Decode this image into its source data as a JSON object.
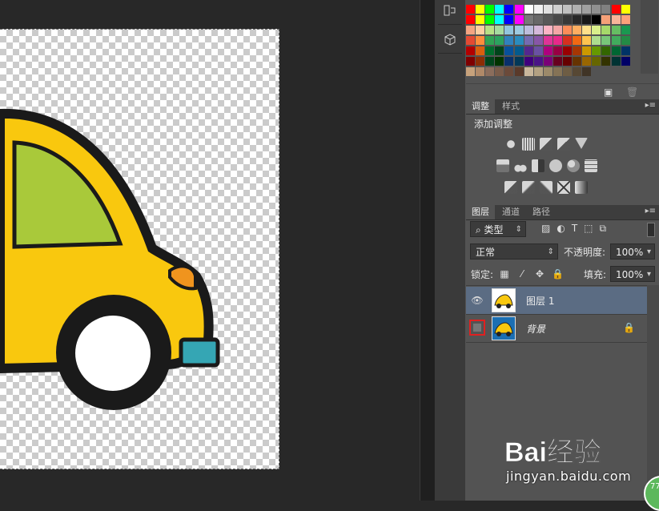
{
  "toolbar_strip": {
    "history_icon": "history-icon",
    "properties_icon": "3d-cube-icon"
  },
  "swatches": {
    "rows": [
      [
        "#ff0000",
        "#ffff00",
        "#00ff00",
        "#00ffff",
        "#0000ff",
        "#ff00ff",
        "#ffffff",
        "#f0f0f0",
        "#e0e0e0",
        "#d0d0d0",
        "#c0c0c0",
        "#b0b0b0",
        "#a0a0a0",
        "#909090",
        "#808080",
        "#ff0000",
        "#ffff00"
      ],
      [
        "#ff0000",
        "#ffff00",
        "#00ff00",
        "#00ffff",
        "#0000ff",
        "#ff00ff",
        "#787878",
        "#686868",
        "#585858",
        "#484848",
        "#383838",
        "#282828",
        "#181818",
        "#000000",
        "#f5a078",
        "#f7b49a",
        "#ffa07a"
      ],
      [
        "#f4a582",
        "#fdd0a2",
        "#b8e186",
        "#a6dba0",
        "#92c5de",
        "#9ecae1",
        "#bcbddc",
        "#d4b9da",
        "#fbb4c4",
        "#f4a6a6",
        "#fc8d59",
        "#fdae61",
        "#fee08b",
        "#d9ef8b",
        "#a6d96a",
        "#66bd63",
        "#1a9850"
      ],
      [
        "#e34a33",
        "#fd8d3c",
        "#31a354",
        "#2ca25f",
        "#3182bd",
        "#2b8cbe",
        "#756bb1",
        "#8856a7",
        "#dd3497",
        "#e7298a",
        "#d7301f",
        "#f16913",
        "#fec44f",
        "#addd8e",
        "#78c679",
        "#41ab5d",
        "#238b45"
      ],
      [
        "#b30000",
        "#d95f0e",
        "#006d2c",
        "#00441b",
        "#08519c",
        "#045a8d",
        "#54278f",
        "#6a51a3",
        "#ae017e",
        "#980043",
        "#990000",
        "#a63603",
        "#cc9900",
        "#669900",
        "#336600",
        "#006633",
        "#003366"
      ],
      [
        "#7f0000",
        "#8c2d04",
        "#00441b",
        "#003300",
        "#08306b",
        "#023858",
        "#3f007d",
        "#4a1486",
        "#7a0177",
        "#67001f",
        "#660000",
        "#663300",
        "#996600",
        "#666600",
        "#333300",
        "#003333",
        "#000066"
      ],
      [
        "#c7a27c",
        "#b08968",
        "#8b6d5c",
        "#7a5c4a",
        "#6b4a3a",
        "#5a3a2a",
        "#c9b79c",
        "#b3a182",
        "#9c8a6a",
        "#857356",
        "#6e5d44",
        "#574834",
        "#403426"
      ]
    ]
  },
  "adjustments_panel": {
    "tabs": [
      "调整",
      "样式"
    ],
    "title": "添加调整"
  },
  "layers_panel": {
    "tabs": [
      "图层",
      "通道",
      "路径"
    ],
    "filter_kind": "类型",
    "blend_mode": "正常",
    "opacity_label": "不透明度:",
    "opacity_value": "100%",
    "lock_label": "锁定:",
    "fill_label": "填充:",
    "fill_value": "100%",
    "layers": [
      {
        "name": "图层 1",
        "visible": true,
        "selected": true
      },
      {
        "name": "背景",
        "visible": false,
        "selected": false,
        "locked": true
      }
    ]
  },
  "watermark": {
    "brand": "Bai经验",
    "url": "jingyan.baidu.com"
  },
  "badge": {
    "text": "77"
  },
  "colors": {
    "car_yellow": "#f9c80e",
    "window_green": "#a9c93a",
    "light_orange": "#f0941e",
    "bumper_teal": "#35a6b4",
    "outline": "#1a1a1a",
    "selected_layer": "#5b6c83"
  }
}
